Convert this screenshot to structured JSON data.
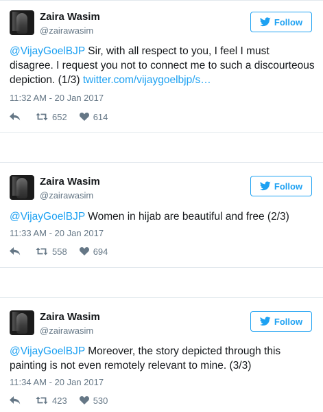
{
  "follow_label": "Follow",
  "tweets": [
    {
      "name": "Zaira Wasim",
      "handle": "@zairawasim",
      "mention": "@VijayGoelBJP",
      "body": " Sir, with all respect to you, I feel I must disagree. I request you not to connect me to such a discourteous depiction. (1/3) ",
      "link_text": "twitter.com/vijaygoelbjp/s…",
      "time": "11:32 AM - 20 Jan 2017",
      "retweets": "652",
      "likes": "614"
    },
    {
      "name": "Zaira Wasim",
      "handle": "@zairawasim",
      "mention": "@VijayGoelBJP",
      "body": " Women in hijab are beautiful and free (2/3)",
      "time": "11:33 AM - 20 Jan 2017",
      "retweets": "558",
      "likes": "694"
    },
    {
      "name": "Zaira Wasim",
      "handle": "@zairawasim",
      "mention": "@VijayGoelBJP",
      "body": " Moreover, the story depicted through this painting is not even remotely relevant to mine. (3/3)",
      "time": "11:34 AM - 20 Jan 2017",
      "retweets": "423",
      "likes": "530"
    }
  ],
  "colors": {
    "accent": "#1da1f2",
    "secondary_text": "#657786",
    "border": "#e1e8ed"
  },
  "icons": [
    "twitter-bird-icon",
    "reply-icon",
    "retweet-icon",
    "heart-icon"
  ]
}
